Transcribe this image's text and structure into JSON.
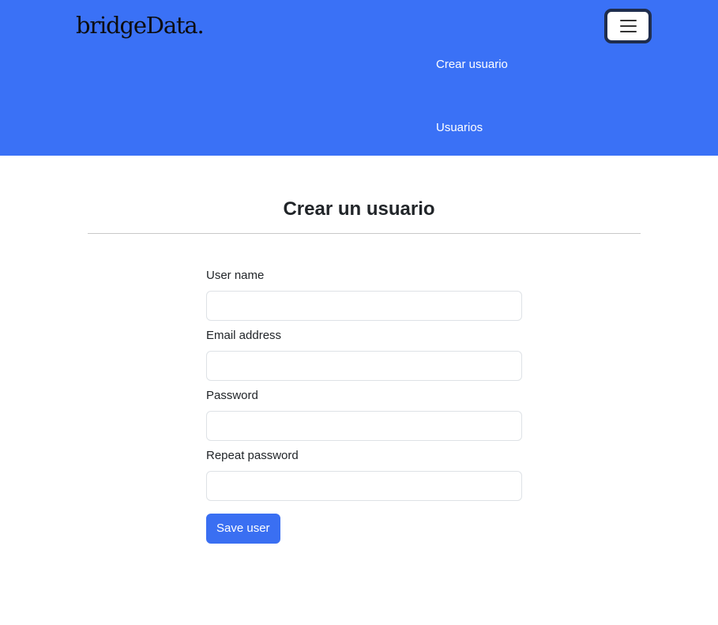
{
  "navbar": {
    "brand": "bridgeData.",
    "toggler_icon": "hamburger-menu-icon",
    "links": [
      {
        "label": "Crear usuario"
      },
      {
        "label": "Usuarios"
      }
    ],
    "background_color": "#3a71f6"
  },
  "main": {
    "title": "Crear un usuario"
  },
  "form": {
    "fields": [
      {
        "label": "User name",
        "value": "",
        "type": "text"
      },
      {
        "label": "Email address",
        "value": "",
        "type": "email"
      },
      {
        "label": "Password",
        "value": "",
        "type": "password"
      },
      {
        "label": "Repeat password",
        "value": "",
        "type": "password"
      }
    ],
    "submit_label": "Save user",
    "button_color": "#3a6ff2"
  }
}
